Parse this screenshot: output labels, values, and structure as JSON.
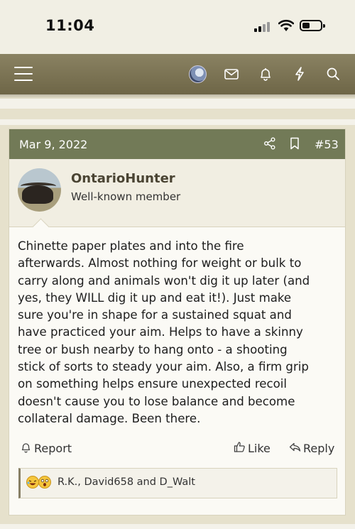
{
  "status_bar": {
    "time": "11:04"
  },
  "nav": {
    "icons": [
      "menu-icon",
      "avatar",
      "mail-icon",
      "bell-icon",
      "bolt-icon",
      "search-icon"
    ]
  },
  "post": {
    "date": "Mar 9, 2022",
    "number": "#53",
    "author": {
      "name": "OntarioHunter",
      "title": "Well-known member"
    },
    "body_lines": [
      "Chinette paper plates and into the fire",
      "afterwards. Almost nothing for weight or bulk to",
      "carry along and animals won't dig it up later (and",
      "yes, they WILL dig it up and eat it!). Just make",
      "sure you're in shape for a sustained squat and",
      "have practiced your aim. Helps to have a skinny",
      "tree or bush nearby to hang onto - a shooting",
      "stick of sorts to steady your aim. Also, a firm grip",
      "on something helps ensure unexpected recoil",
      "doesn't cause you to lose balance and become",
      "collateral damage. Been there."
    ],
    "actions": {
      "report": "Report",
      "like": "Like",
      "reply": "Reply"
    },
    "reactions": {
      "names": "R.K., David658 and D_Walt",
      "emojis": [
        "laughing-emoji",
        "surprised-emoji"
      ]
    }
  },
  "colors": {
    "nav_bar": "#7d7556",
    "post_header": "#727a57",
    "background": "#e6e1cc"
  }
}
